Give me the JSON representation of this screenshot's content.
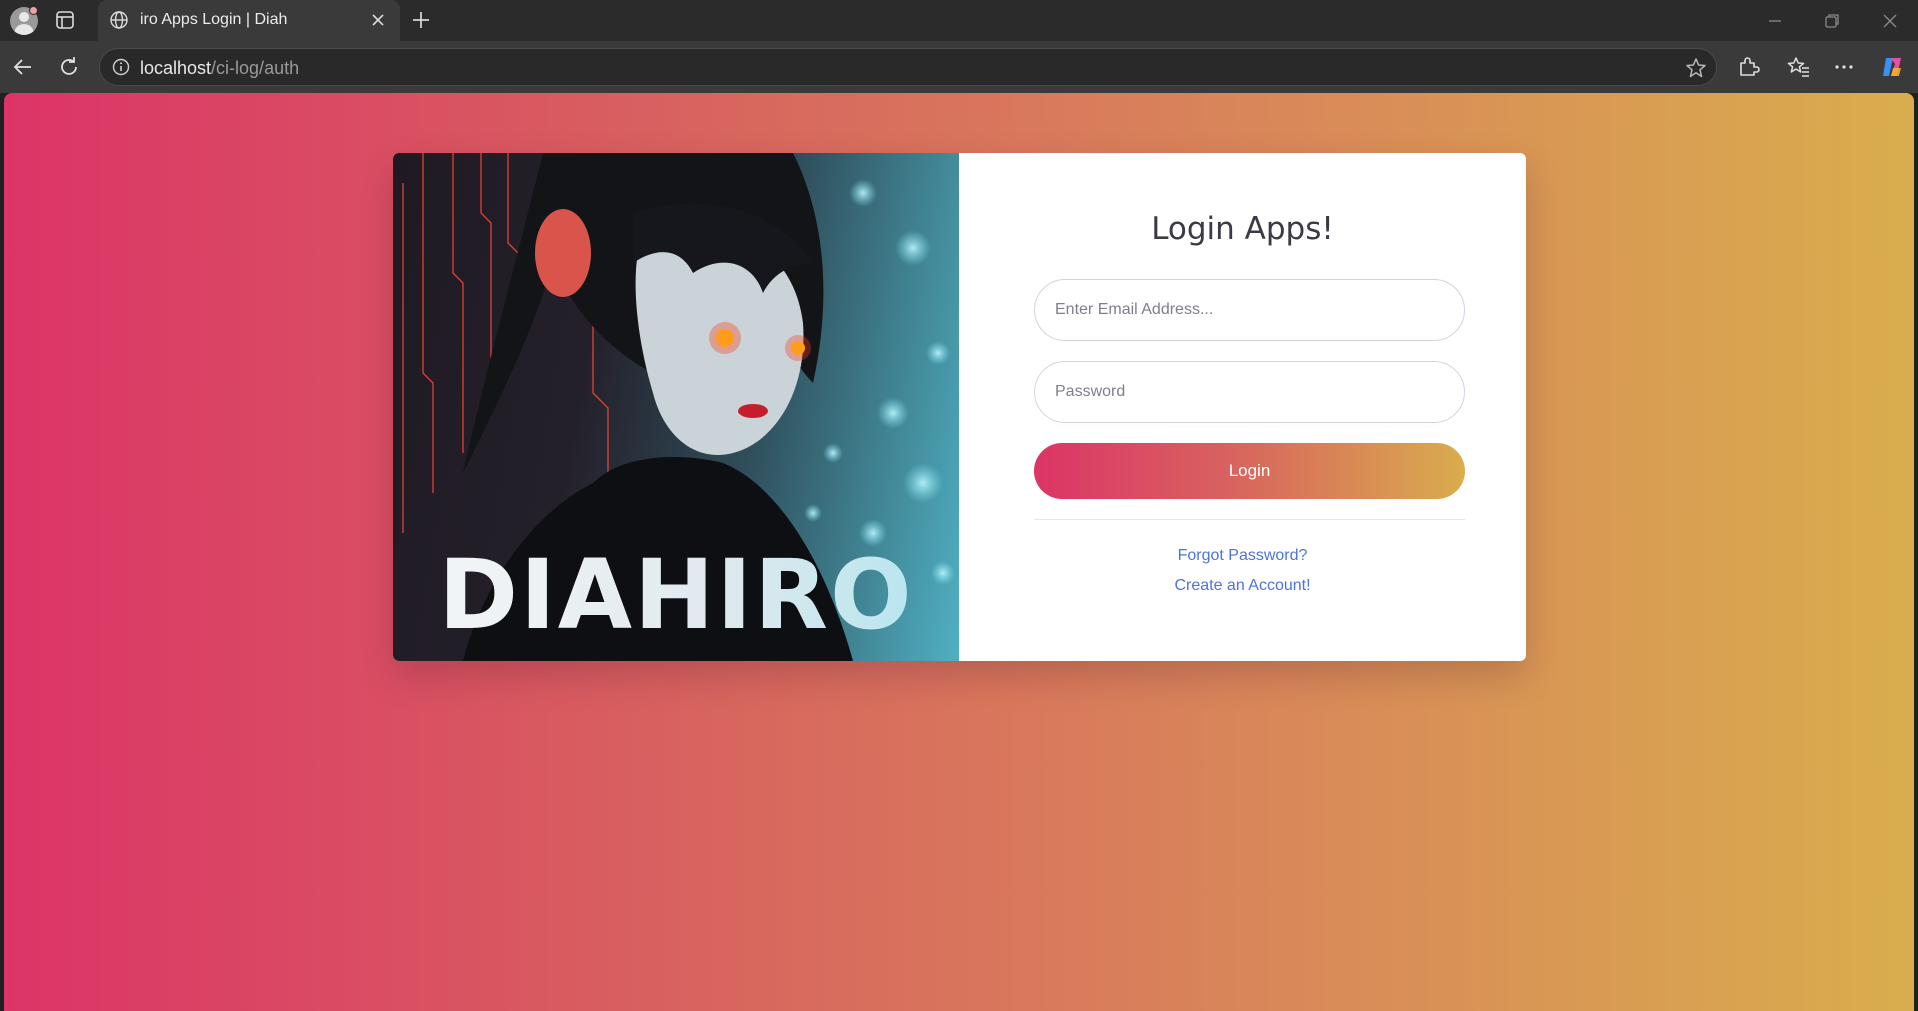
{
  "browser": {
    "tab_title": "iro Apps Login | Diah",
    "url_host": "localhost",
    "url_path": "/ci-log/auth"
  },
  "hero": {
    "logo_text": "DIAHIRO"
  },
  "login": {
    "heading": "Login Apps!",
    "email_placeholder": "Enter Email Address...",
    "password_placeholder": "Password",
    "submit_label": "Login",
    "forgot_link": "Forgot Password?",
    "register_link": "Create an Account!"
  },
  "colors": {
    "gradient_start": "#dc3467",
    "gradient_end": "#d9ad4d",
    "link": "#4e73df"
  }
}
